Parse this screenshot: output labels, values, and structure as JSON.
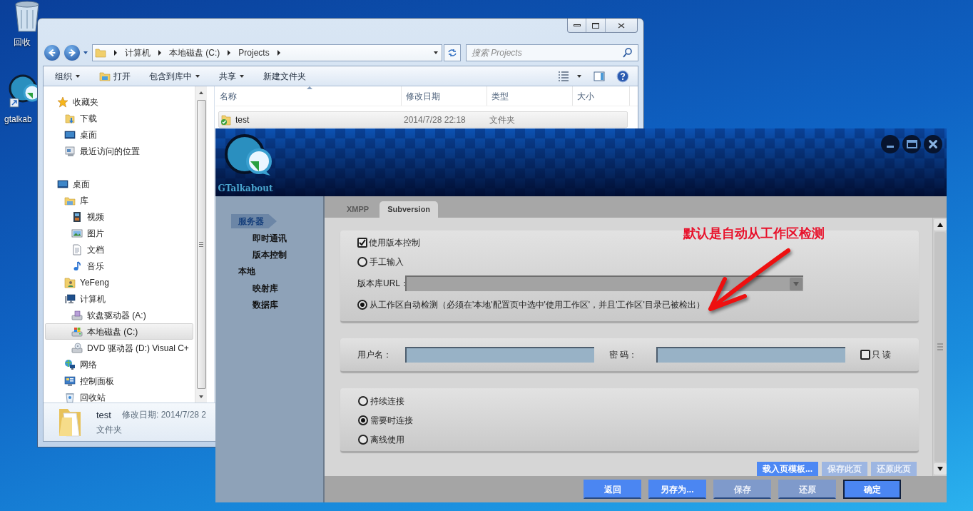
{
  "desktop_icons": [
    {
      "label": "回收",
      "kind": "recycle"
    },
    {
      "label": "gtalkab",
      "kind": "app"
    }
  ],
  "explorer": {
    "breadcrumb": [
      "计算机",
      "本地磁盘 (C:)",
      "Projects"
    ],
    "search": {
      "placeholder": "搜索 Projects"
    },
    "toolbar": [
      {
        "label": "组织",
        "kind": "menu"
      },
      {
        "label": "打开",
        "kind": "icon"
      },
      {
        "label": "包含到库中",
        "kind": "menu"
      },
      {
        "label": "共享",
        "kind": "menu"
      },
      {
        "label": "新建文件夹",
        "kind": "plain"
      }
    ],
    "nav": [
      {
        "label": "收藏夹",
        "kind": "star",
        "selected": false,
        "children": [
          {
            "label": "下载",
            "kind": "download",
            "selected": false
          },
          {
            "label": "桌面",
            "kind": "desktop",
            "selected": false
          },
          {
            "label": "最近访问的位置",
            "kind": "recent",
            "selected": false
          }
        ]
      },
      {
        "label": "桌面",
        "kind": "desktop",
        "selected": false,
        "children": [
          {
            "label": "库",
            "kind": "library",
            "selected": false,
            "children": [
              {
                "label": "视频",
                "kind": "video",
                "selected": false
              },
              {
                "label": "图片",
                "kind": "picture",
                "selected": false
              },
              {
                "label": "文档",
                "kind": "document",
                "selected": false
              },
              {
                "label": "音乐",
                "kind": "music",
                "selected": false
              }
            ]
          },
          {
            "label": "YeFeng",
            "kind": "user",
            "selected": false
          },
          {
            "label": "计算机",
            "kind": "computer",
            "selected": false,
            "children": [
              {
                "label": "软盘驱动器 (A:)",
                "kind": "floppy",
                "selected": false
              },
              {
                "label": "本地磁盘 (C:)",
                "kind": "disk",
                "selected": true
              },
              {
                "label": "DVD 驱动器 (D:) Visual C+",
                "kind": "dvd",
                "selected": false
              }
            ]
          },
          {
            "label": "网络",
            "kind": "network",
            "selected": false
          },
          {
            "label": "控制面板",
            "kind": "control",
            "selected": false
          },
          {
            "label": "回收站",
            "kind": "recycle",
            "selected": false
          }
        ]
      }
    ],
    "columns": [
      "名称",
      "修改日期",
      "类型",
      "大小"
    ],
    "rows": [
      {
        "name": "test",
        "modified": "2014/7/28 22:18",
        "type": "文件夹",
        "selected": true
      }
    ],
    "details": {
      "name": "test",
      "modified": "修改日期: 2014/7/28 2",
      "type": "文件夹"
    }
  },
  "app": {
    "title": "GTalkabout",
    "sidebar": [
      {
        "label": "服务器",
        "selected": true,
        "children": [
          {
            "label": "即时通讯",
            "selected": false
          },
          {
            "label": "版本控制",
            "selected": false
          }
        ]
      },
      {
        "label": "本地",
        "selected": false,
        "children": [
          {
            "label": "映射库",
            "selected": false
          },
          {
            "label": "数据库",
            "selected": false
          }
        ]
      }
    ],
    "tabs": [
      {
        "label": "XMPP",
        "selected": false
      },
      {
        "label": "Subversion",
        "selected": true
      }
    ],
    "source_panel": [
      {
        "kind": "checkbox",
        "label": "使用版本控制",
        "checked": true
      },
      {
        "kind": "radio",
        "label": "手工输入",
        "selected": false
      },
      {
        "kind": "select",
        "label": "版本库URL：",
        "disabled": true
      },
      {
        "kind": "radio",
        "label": "从工作区自动检测（必须在'本地'配置页中选中'使用工作区'，并且'工作区'目录已被检出）",
        "selected": true
      }
    ],
    "credentials": {
      "username_label": "用户名：",
      "password_label": "密 码：",
      "readonly": {
        "label": "只 读",
        "checked": false
      }
    },
    "connection": [
      {
        "label": "持续连接",
        "selected": false
      },
      {
        "label": "需要时连接",
        "selected": true
      },
      {
        "label": "离线使用",
        "selected": false
      }
    ],
    "page_buttons": [
      {
        "label": "载入页模板...",
        "disabled": false
      },
      {
        "label": "保存此页",
        "disabled": true
      },
      {
        "label": "还原此页",
        "disabled": true
      }
    ],
    "footer_buttons": [
      {
        "label": "返回",
        "disabled": false,
        "default": false
      },
      {
        "label": "另存为...",
        "disabled": false,
        "default": false
      },
      {
        "label": "保存",
        "disabled": true,
        "default": false
      },
      {
        "label": "还原",
        "disabled": true,
        "default": false
      },
      {
        "label": "确定",
        "disabled": false,
        "default": true
      }
    ]
  },
  "annotation": {
    "text": "默认是自动从工作区检测"
  }
}
